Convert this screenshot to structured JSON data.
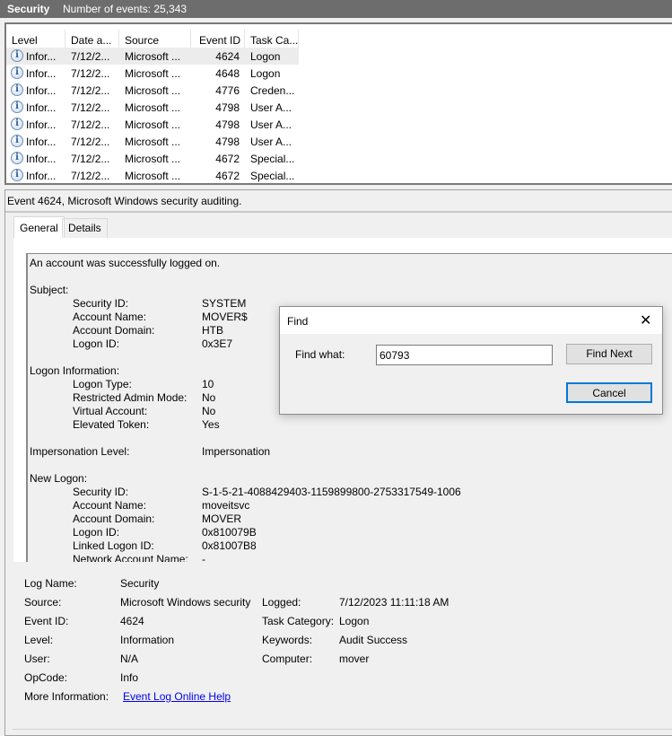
{
  "header": {
    "title": "Security",
    "count": "Number of events: 25,343"
  },
  "list": {
    "columns": [
      "Level",
      "Date a...",
      "Source",
      "Event ID",
      "Task Ca..."
    ],
    "rows": [
      {
        "level": "Infor...",
        "date": "7/12/2...",
        "source": "Microsoft ...",
        "id": "4624",
        "task": "Logon"
      },
      {
        "level": "Infor...",
        "date": "7/12/2...",
        "source": "Microsoft ...",
        "id": "4648",
        "task": "Logon"
      },
      {
        "level": "Infor...",
        "date": "7/12/2...",
        "source": "Microsoft ...",
        "id": "4776",
        "task": "Creden..."
      },
      {
        "level": "Infor...",
        "date": "7/12/2...",
        "source": "Microsoft ...",
        "id": "4798",
        "task": "User A..."
      },
      {
        "level": "Infor...",
        "date": "7/12/2...",
        "source": "Microsoft ...",
        "id": "4798",
        "task": "User A..."
      },
      {
        "level": "Infor...",
        "date": "7/12/2...",
        "source": "Microsoft ...",
        "id": "4798",
        "task": "User A..."
      },
      {
        "level": "Infor...",
        "date": "7/12/2...",
        "source": "Microsoft ...",
        "id": "4672",
        "task": "Special..."
      },
      {
        "level": "Infor...",
        "date": "7/12/2...",
        "source": "Microsoft ...",
        "id": "4672",
        "task": "Special..."
      }
    ]
  },
  "preview": {
    "title": "Event 4624, Microsoft Windows security auditing.",
    "tabs": [
      "General",
      "Details"
    ],
    "message": [
      {
        "t": "An account was successfully logged on."
      },
      {
        "t": ""
      },
      {
        "t": "Subject:"
      },
      {
        "k": "Security ID:",
        "v": "SYSTEM"
      },
      {
        "k": "Account Name:",
        "v": "MOVER$"
      },
      {
        "k": "Account Domain:",
        "v": "HTB"
      },
      {
        "k": "Logon ID:",
        "v": "0x3E7"
      },
      {
        "t": ""
      },
      {
        "t": "Logon Information:"
      },
      {
        "k": "Logon Type:",
        "v": "10"
      },
      {
        "k": "Restricted Admin Mode:",
        "v": "No"
      },
      {
        "k": "Virtual Account:",
        "v": "No"
      },
      {
        "k": "Elevated Token:",
        "v": "Yes"
      },
      {
        "t": ""
      },
      {
        "t": "Impersonation Level:",
        "v": "Impersonation"
      },
      {
        "t": ""
      },
      {
        "t": "New Logon:"
      },
      {
        "k": "Security ID:",
        "v": "S-1-5-21-4088429403-1159899800-2753317549-1006"
      },
      {
        "k": "Account Name:",
        "v": "moveitsvc"
      },
      {
        "k": "Account Domain:",
        "v": "MOVER"
      },
      {
        "k": "Logon ID:",
        "v": "0x810079B"
      },
      {
        "k": "Linked Logon ID:",
        "v": "0x81007B8"
      },
      {
        "k": "Network Account Name:",
        "v": "-"
      }
    ],
    "fields": {
      "log_name_label": "Log Name:",
      "log_name": "Security",
      "source_label": "Source:",
      "source": "Microsoft Windows security",
      "event_id_label": "Event ID:",
      "event_id": "4624",
      "level_label": "Level:",
      "level": "Information",
      "user_label": "User:",
      "user": "N/A",
      "opcode_label": "OpCode:",
      "opcode": "Info",
      "more_info_label": "More Information:",
      "more_info_link": "Event Log Online Help",
      "logged_label": "Logged:",
      "logged": "7/12/2023 11:11:18 AM",
      "task_label": "Task Category:",
      "task": "Logon",
      "keywords_label": "Keywords:",
      "keywords": "Audit Success",
      "computer_label": "Computer:",
      "computer": "mover"
    }
  },
  "find": {
    "title": "Find",
    "label": "Find what:",
    "value": "60793",
    "find_next": "Find Next",
    "cancel": "Cancel",
    "close": "✕"
  }
}
